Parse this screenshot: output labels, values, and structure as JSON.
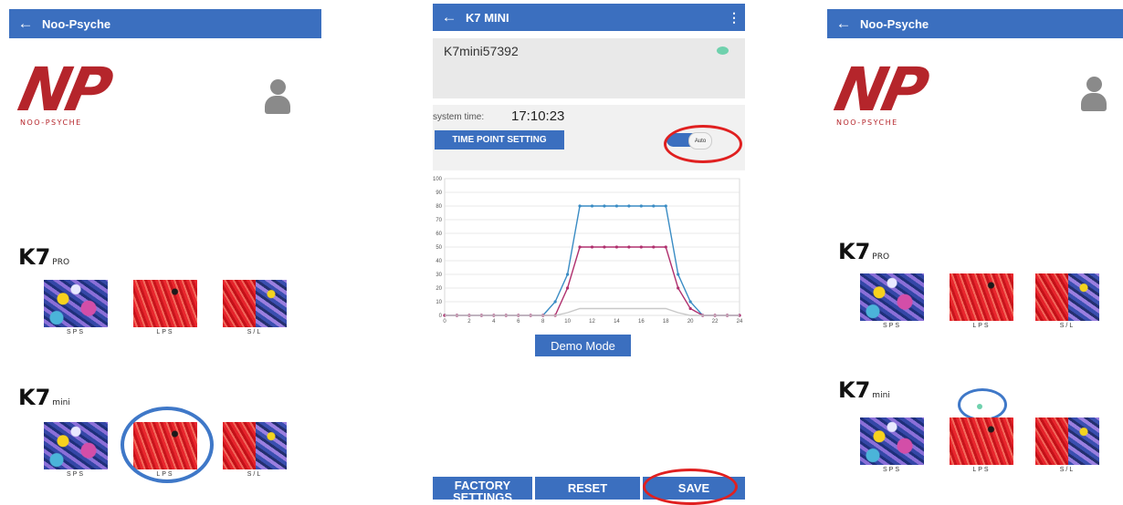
{
  "left_screen": {
    "appbar": {
      "back_icon": "arrow-left-icon",
      "title": "Noo-Psyche"
    },
    "logo": {
      "letters": "NP",
      "subtitle": "NOO-PSYCHE"
    },
    "k7pro": {
      "name": "K7",
      "suffix": "PRO",
      "tiles": [
        "SPS",
        "LPS",
        "S/L"
      ]
    },
    "k7mini": {
      "name": "K7",
      "suffix": "mini",
      "tiles": [
        "SPS",
        "LPS",
        "S/L"
      ]
    }
  },
  "middle_screen": {
    "appbar": {
      "back_icon": "arrow-left-icon",
      "title": "K7 MINI",
      "menu_icon": "kebab-menu-icon"
    },
    "device_name": "K7mini57392",
    "system_time_label": "system time:",
    "system_time_value": "17:10:23",
    "time_point_button": "TIME POINT SETTING",
    "auto_toggle_label": "Auto",
    "demo_button": "Demo Mode",
    "factory_button": "FACTORY SETTINGS",
    "reset_button": "RESET",
    "save_button": "SAVE"
  },
  "right_screen": {
    "appbar": {
      "back_icon": "arrow-left-icon",
      "title": "Noo-Psyche"
    },
    "logo": {
      "letters": "NP",
      "subtitle": "NOO-PSYCHE"
    },
    "k7pro": {
      "name": "K7",
      "suffix": "PRO",
      "tiles": [
        "SPS",
        "LPS",
        "S/L"
      ]
    },
    "k7mini": {
      "name": "K7",
      "suffix": "mini",
      "tiles": [
        "SPS",
        "LPS",
        "S/L"
      ]
    }
  },
  "colors": {
    "appbar": "#3b6fbf",
    "logo_red": "#b5252b",
    "annotation_red": "#e02020",
    "annotation_blue": "#3f78c8",
    "status_dot": "#6fd1ad"
  },
  "chart_data": {
    "type": "line",
    "x": [
      0,
      1,
      2,
      3,
      4,
      5,
      6,
      7,
      8,
      9,
      10,
      11,
      12,
      13,
      14,
      15,
      16,
      17,
      18,
      19,
      20,
      21,
      22,
      23,
      24
    ],
    "xticks": [
      "0",
      "2",
      "4",
      "6",
      "8",
      "10",
      "12",
      "14",
      "16",
      "18",
      "20",
      "22",
      "24"
    ],
    "yticks": [
      "0",
      "10",
      "20",
      "30",
      "40",
      "50",
      "60",
      "70",
      "80",
      "90",
      "100"
    ],
    "xlim": [
      0,
      24
    ],
    "ylim": [
      0,
      100
    ],
    "grid": true,
    "series": [
      {
        "color": "#3a8cc4",
        "values": [
          0,
          0,
          0,
          0,
          0,
          0,
          0,
          0,
          0,
          10,
          30,
          80,
          80,
          80,
          80,
          80,
          80,
          80,
          80,
          30,
          10,
          0,
          0,
          0,
          0
        ]
      },
      {
        "color": "#b0306e",
        "values": [
          0,
          0,
          0,
          0,
          0,
          0,
          0,
          0,
          0,
          0,
          20,
          50,
          50,
          50,
          50,
          50,
          50,
          50,
          50,
          20,
          5,
          0,
          0,
          0,
          0
        ]
      },
      {
        "color": "#c8c8c8",
        "values": [
          0,
          0,
          0,
          0,
          0,
          0,
          0,
          0,
          0,
          0,
          2,
          5,
          5,
          5,
          5,
          5,
          5,
          5,
          5,
          2,
          0,
          0,
          0,
          0,
          0
        ]
      }
    ]
  }
}
